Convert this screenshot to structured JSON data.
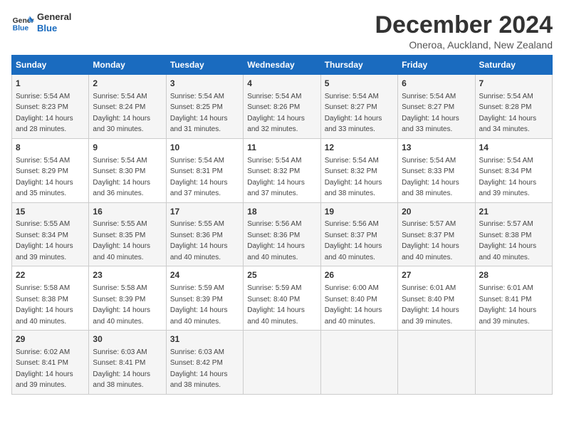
{
  "logo": {
    "text_general": "General",
    "text_blue": "Blue"
  },
  "title": "December 2024",
  "location": "Oneroa, Auckland, New Zealand",
  "headers": [
    "Sunday",
    "Monday",
    "Tuesday",
    "Wednesday",
    "Thursday",
    "Friday",
    "Saturday"
  ],
  "weeks": [
    [
      {
        "day": "1",
        "sunrise": "5:54 AM",
        "sunset": "8:23 PM",
        "daylight": "14 hours and 28 minutes."
      },
      {
        "day": "2",
        "sunrise": "5:54 AM",
        "sunset": "8:24 PM",
        "daylight": "14 hours and 30 minutes."
      },
      {
        "day": "3",
        "sunrise": "5:54 AM",
        "sunset": "8:25 PM",
        "daylight": "14 hours and 31 minutes."
      },
      {
        "day": "4",
        "sunrise": "5:54 AM",
        "sunset": "8:26 PM",
        "daylight": "14 hours and 32 minutes."
      },
      {
        "day": "5",
        "sunrise": "5:54 AM",
        "sunset": "8:27 PM",
        "daylight": "14 hours and 33 minutes."
      },
      {
        "day": "6",
        "sunrise": "5:54 AM",
        "sunset": "8:27 PM",
        "daylight": "14 hours and 33 minutes."
      },
      {
        "day": "7",
        "sunrise": "5:54 AM",
        "sunset": "8:28 PM",
        "daylight": "14 hours and 34 minutes."
      }
    ],
    [
      {
        "day": "8",
        "sunrise": "5:54 AM",
        "sunset": "8:29 PM",
        "daylight": "14 hours and 35 minutes."
      },
      {
        "day": "9",
        "sunrise": "5:54 AM",
        "sunset": "8:30 PM",
        "daylight": "14 hours and 36 minutes."
      },
      {
        "day": "10",
        "sunrise": "5:54 AM",
        "sunset": "8:31 PM",
        "daylight": "14 hours and 37 minutes."
      },
      {
        "day": "11",
        "sunrise": "5:54 AM",
        "sunset": "8:32 PM",
        "daylight": "14 hours and 37 minutes."
      },
      {
        "day": "12",
        "sunrise": "5:54 AM",
        "sunset": "8:32 PM",
        "daylight": "14 hours and 38 minutes."
      },
      {
        "day": "13",
        "sunrise": "5:54 AM",
        "sunset": "8:33 PM",
        "daylight": "14 hours and 38 minutes."
      },
      {
        "day": "14",
        "sunrise": "5:54 AM",
        "sunset": "8:34 PM",
        "daylight": "14 hours and 39 minutes."
      }
    ],
    [
      {
        "day": "15",
        "sunrise": "5:55 AM",
        "sunset": "8:34 PM",
        "daylight": "14 hours and 39 minutes."
      },
      {
        "day": "16",
        "sunrise": "5:55 AM",
        "sunset": "8:35 PM",
        "daylight": "14 hours and 40 minutes."
      },
      {
        "day": "17",
        "sunrise": "5:55 AM",
        "sunset": "8:36 PM",
        "daylight": "14 hours and 40 minutes."
      },
      {
        "day": "18",
        "sunrise": "5:56 AM",
        "sunset": "8:36 PM",
        "daylight": "14 hours and 40 minutes."
      },
      {
        "day": "19",
        "sunrise": "5:56 AM",
        "sunset": "8:37 PM",
        "daylight": "14 hours and 40 minutes."
      },
      {
        "day": "20",
        "sunrise": "5:57 AM",
        "sunset": "8:37 PM",
        "daylight": "14 hours and 40 minutes."
      },
      {
        "day": "21",
        "sunrise": "5:57 AM",
        "sunset": "8:38 PM",
        "daylight": "14 hours and 40 minutes."
      }
    ],
    [
      {
        "day": "22",
        "sunrise": "5:58 AM",
        "sunset": "8:38 PM",
        "daylight": "14 hours and 40 minutes."
      },
      {
        "day": "23",
        "sunrise": "5:58 AM",
        "sunset": "8:39 PM",
        "daylight": "14 hours and 40 minutes."
      },
      {
        "day": "24",
        "sunrise": "5:59 AM",
        "sunset": "8:39 PM",
        "daylight": "14 hours and 40 minutes."
      },
      {
        "day": "25",
        "sunrise": "5:59 AM",
        "sunset": "8:40 PM",
        "daylight": "14 hours and 40 minutes."
      },
      {
        "day": "26",
        "sunrise": "6:00 AM",
        "sunset": "8:40 PM",
        "daylight": "14 hours and 40 minutes."
      },
      {
        "day": "27",
        "sunrise": "6:01 AM",
        "sunset": "8:40 PM",
        "daylight": "14 hours and 39 minutes."
      },
      {
        "day": "28",
        "sunrise": "6:01 AM",
        "sunset": "8:41 PM",
        "daylight": "14 hours and 39 minutes."
      }
    ],
    [
      {
        "day": "29",
        "sunrise": "6:02 AM",
        "sunset": "8:41 PM",
        "daylight": "14 hours and 39 minutes."
      },
      {
        "day": "30",
        "sunrise": "6:03 AM",
        "sunset": "8:41 PM",
        "daylight": "14 hours and 38 minutes."
      },
      {
        "day": "31",
        "sunrise": "6:03 AM",
        "sunset": "8:42 PM",
        "daylight": "14 hours and 38 minutes."
      },
      null,
      null,
      null,
      null
    ]
  ]
}
